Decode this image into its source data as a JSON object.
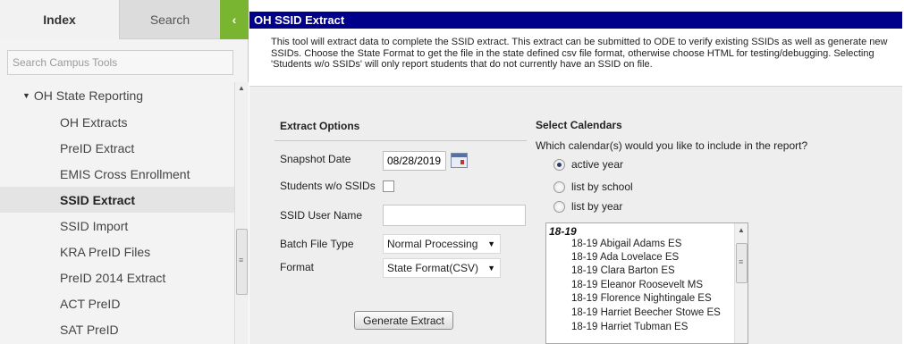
{
  "sidebar": {
    "tabs": {
      "index": "Index",
      "search": "Search",
      "collapse": "‹"
    },
    "search_placeholder": "Search Campus Tools",
    "tree": {
      "parent": "OH State Reporting",
      "items": [
        {
          "label": "OH Extracts"
        },
        {
          "label": "PreID Extract"
        },
        {
          "label": "EMIS Cross Enrollment"
        },
        {
          "label": "SSID Extract",
          "active": true
        },
        {
          "label": "SSID Import"
        },
        {
          "label": "KRA PreID Files"
        },
        {
          "label": "PreID 2014 Extract"
        },
        {
          "label": "ACT PreID"
        },
        {
          "label": "SAT PreID"
        }
      ]
    }
  },
  "main": {
    "title": "OH SSID Extract",
    "description": "This tool will extract data to complete the SSID extract. This extract can be submitted to ODE to verify existing SSIDs as well as generate new SSIDs. Choose the State Format to get the file in the state defined csv file format, otherwise choose HTML for testing/debugging. Selecting 'Students w/o SSIDs' will only report students that do not currently have an SSID on file.",
    "extract_options": {
      "heading": "Extract Options",
      "snapshot_date_label": "Snapshot Date",
      "snapshot_date_value": "08/28/2019",
      "students_wo_ssids_label": "Students w/o SSIDs",
      "students_wo_ssids_checked": false,
      "ssid_user_name_label": "SSID User Name",
      "ssid_user_name_value": "",
      "batch_file_type_label": "Batch File Type",
      "batch_file_type_value": "Normal Processing",
      "format_label": "Format",
      "format_value": "State Format(CSV)",
      "generate_button": "Generate Extract"
    },
    "calendars": {
      "heading": "Select Calendars",
      "question": "Which calendar(s) would you like to include in the report?",
      "options": [
        {
          "label": "active year",
          "selected": true
        },
        {
          "label": "list by school",
          "selected": false
        },
        {
          "label": "list by year",
          "selected": false
        }
      ],
      "group": "18-19",
      "items": [
        "18-19 Abigail Adams ES",
        "18-19 Ada Lovelace ES",
        "18-19 Clara Barton ES",
        "18-19 Eleanor Roosevelt MS",
        "18-19 Florence Nightingale ES",
        "18-19 Harriet Beecher Stowe ES",
        "18-19 Harriet Tubman ES"
      ]
    }
  },
  "colors": {
    "title_bar": "#00008b",
    "collapse_button": "#7ab531",
    "selected_nav": "#e4e4e4"
  }
}
